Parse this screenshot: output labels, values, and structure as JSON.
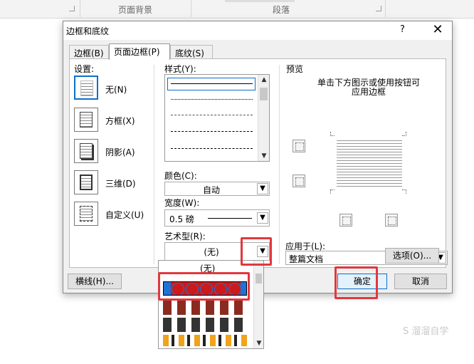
{
  "ribbon": {
    "groups": [
      "页面背景",
      "段落"
    ]
  },
  "dialog": {
    "title": "边框和底纹",
    "help": "?",
    "close": "✕",
    "tabs": [
      {
        "label": "边框(B)"
      },
      {
        "label": "页面边框(P)"
      },
      {
        "label": "底纹(S)"
      }
    ],
    "settings": {
      "header": "设置:",
      "items": [
        {
          "label": "无(N)"
        },
        {
          "label": "方框(X)"
        },
        {
          "label": "阴影(A)"
        },
        {
          "label": "三维(D)"
        },
        {
          "label": "自定义(U)"
        }
      ]
    },
    "style": {
      "header": "样式(Y):"
    },
    "color": {
      "label": "颜色(C):",
      "value": "自动"
    },
    "width": {
      "label": "宽度(W):",
      "value": "0.5 磅"
    },
    "art": {
      "label": "艺术型(R):",
      "value": "(无)",
      "dropdown_first": "(无)"
    },
    "preview": {
      "header": "预览",
      "hint1": "单击下方图示或使用按钮可",
      "hint2": "应用边框"
    },
    "apply": {
      "label": "应用于(L):",
      "value": "整篇文档"
    },
    "buttons": {
      "options": "选项(O)...",
      "horizontal_line": "横线(H)...",
      "ok": "确定",
      "cancel": "取消"
    }
  },
  "colors": {
    "accent": "#0d6fc7",
    "highlight": "#e0383e",
    "art_blue": "#1e73d6",
    "art_red": "#cc1a1a"
  },
  "watermark": "S 溜溜自学"
}
